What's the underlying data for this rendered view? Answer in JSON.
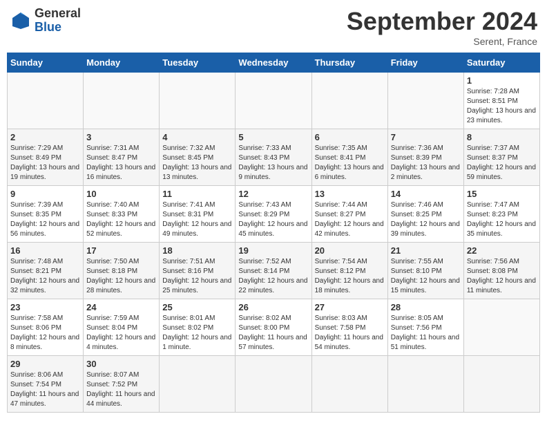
{
  "header": {
    "logo_general": "General",
    "logo_blue": "Blue",
    "title": "September 2024",
    "location": "Serent, France"
  },
  "calendar": {
    "days_of_week": [
      "Sunday",
      "Monday",
      "Tuesday",
      "Wednesday",
      "Thursday",
      "Friday",
      "Saturday"
    ],
    "weeks": [
      [
        null,
        null,
        null,
        null,
        null,
        null,
        {
          "day": "1",
          "sunrise": "7:28 AM",
          "sunset": "8:51 PM",
          "daylight": "13 hours and 23 minutes."
        }
      ],
      [
        {
          "day": "2",
          "sunrise": "7:29 AM",
          "sunset": "8:49 PM",
          "daylight": "13 hours and 19 minutes."
        },
        {
          "day": "3",
          "sunrise": "7:31 AM",
          "sunset": "8:47 PM",
          "daylight": "13 hours and 16 minutes."
        },
        {
          "day": "4",
          "sunrise": "7:32 AM",
          "sunset": "8:45 PM",
          "daylight": "13 hours and 13 minutes."
        },
        {
          "day": "5",
          "sunrise": "7:33 AM",
          "sunset": "8:43 PM",
          "daylight": "13 hours and 9 minutes."
        },
        {
          "day": "6",
          "sunrise": "7:35 AM",
          "sunset": "8:41 PM",
          "daylight": "13 hours and 6 minutes."
        },
        {
          "day": "7",
          "sunrise": "7:36 AM",
          "sunset": "8:39 PM",
          "daylight": "13 hours and 2 minutes."
        },
        {
          "day": "8",
          "sunrise": "7:37 AM",
          "sunset": "8:37 PM",
          "daylight": "12 hours and 59 minutes."
        }
      ],
      [
        {
          "day": "9",
          "sunrise": "7:39 AM",
          "sunset": "8:35 PM",
          "daylight": "12 hours and 56 minutes."
        },
        {
          "day": "10",
          "sunrise": "7:40 AM",
          "sunset": "8:33 PM",
          "daylight": "12 hours and 52 minutes."
        },
        {
          "day": "11",
          "sunrise": "7:41 AM",
          "sunset": "8:31 PM",
          "daylight": "12 hours and 49 minutes."
        },
        {
          "day": "12",
          "sunrise": "7:43 AM",
          "sunset": "8:29 PM",
          "daylight": "12 hours and 45 minutes."
        },
        {
          "day": "13",
          "sunrise": "7:44 AM",
          "sunset": "8:27 PM",
          "daylight": "12 hours and 42 minutes."
        },
        {
          "day": "14",
          "sunrise": "7:46 AM",
          "sunset": "8:25 PM",
          "daylight": "12 hours and 39 minutes."
        },
        {
          "day": "15",
          "sunrise": "7:47 AM",
          "sunset": "8:23 PM",
          "daylight": "12 hours and 35 minutes."
        }
      ],
      [
        {
          "day": "16",
          "sunrise": "7:48 AM",
          "sunset": "8:21 PM",
          "daylight": "12 hours and 32 minutes."
        },
        {
          "day": "17",
          "sunrise": "7:50 AM",
          "sunset": "8:18 PM",
          "daylight": "12 hours and 28 minutes."
        },
        {
          "day": "18",
          "sunrise": "7:51 AM",
          "sunset": "8:16 PM",
          "daylight": "12 hours and 25 minutes."
        },
        {
          "day": "19",
          "sunrise": "7:52 AM",
          "sunset": "8:14 PM",
          "daylight": "12 hours and 22 minutes."
        },
        {
          "day": "20",
          "sunrise": "7:54 AM",
          "sunset": "8:12 PM",
          "daylight": "12 hours and 18 minutes."
        },
        {
          "day": "21",
          "sunrise": "7:55 AM",
          "sunset": "8:10 PM",
          "daylight": "12 hours and 15 minutes."
        },
        {
          "day": "22",
          "sunrise": "7:56 AM",
          "sunset": "8:08 PM",
          "daylight": "12 hours and 11 minutes."
        }
      ],
      [
        {
          "day": "23",
          "sunrise": "7:58 AM",
          "sunset": "8:06 PM",
          "daylight": "12 hours and 8 minutes."
        },
        {
          "day": "24",
          "sunrise": "7:59 AM",
          "sunset": "8:04 PM",
          "daylight": "12 hours and 4 minutes."
        },
        {
          "day": "25",
          "sunrise": "8:01 AM",
          "sunset": "8:02 PM",
          "daylight": "12 hours and 1 minute."
        },
        {
          "day": "26",
          "sunrise": "8:02 AM",
          "sunset": "8:00 PM",
          "daylight": "11 hours and 57 minutes."
        },
        {
          "day": "27",
          "sunrise": "8:03 AM",
          "sunset": "7:58 PM",
          "daylight": "11 hours and 54 minutes."
        },
        {
          "day": "28",
          "sunrise": "8:05 AM",
          "sunset": "7:56 PM",
          "daylight": "11 hours and 51 minutes."
        },
        null
      ],
      [
        {
          "day": "29",
          "sunrise": "8:06 AM",
          "sunset": "7:54 PM",
          "daylight": "11 hours and 47 minutes."
        },
        {
          "day": "30",
          "sunrise": "8:07 AM",
          "sunset": "7:52 PM",
          "daylight": "11 hours and 44 minutes."
        },
        null,
        null,
        null,
        null,
        null
      ]
    ]
  }
}
